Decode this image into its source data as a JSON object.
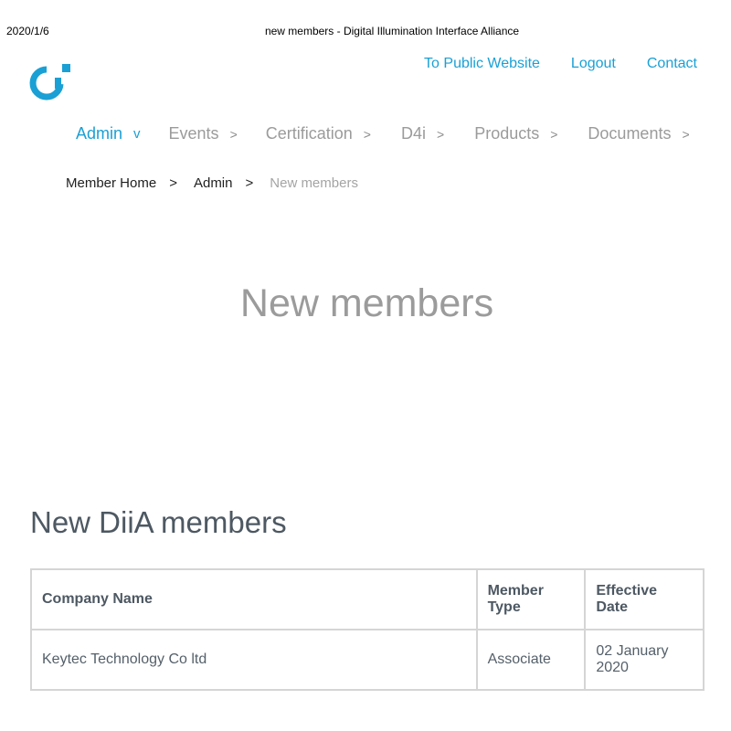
{
  "print_header": {
    "date": "2020/1/6",
    "title": "new members - Digital Illumination Interface Alliance"
  },
  "colors": {
    "accent": "#1aa0d5",
    "nav_inactive": "#9b9b9b",
    "heading": "#4d5862",
    "border": "#d5d5d5"
  },
  "logo": {
    "icon": "diia-logo-icon"
  },
  "top_links": {
    "public_website": "To Public Website",
    "logout": "Logout",
    "contact": "Contact"
  },
  "main_nav": {
    "items": [
      {
        "label": "Admin",
        "sep": "v",
        "active": true
      },
      {
        "label": "Events",
        "sep": ">"
      },
      {
        "label": "Certification",
        "sep": ">"
      },
      {
        "label": "D4i",
        "sep": ">"
      },
      {
        "label": "Products",
        "sep": ">"
      },
      {
        "label": "Documents",
        "sep": ">"
      }
    ]
  },
  "breadcrumb": {
    "items": [
      "Member Home",
      "Admin",
      "New members"
    ],
    "separator": ">"
  },
  "page_title": "New members",
  "section_title": "New DiiA members",
  "table": {
    "headers": [
      "Company Name",
      "Member Type",
      "Effective Date"
    ],
    "rows": [
      [
        "Keytec Technology Co ltd",
        "Associate",
        "02 January 2020"
      ]
    ]
  }
}
